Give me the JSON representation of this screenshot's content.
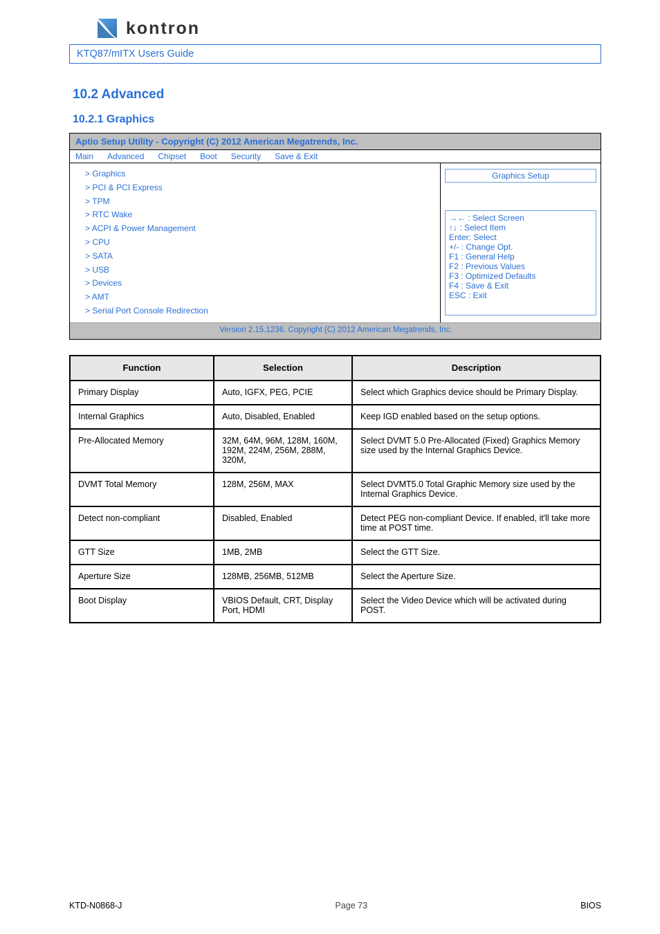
{
  "logo_text": "kontron",
  "titlebar": "KTQ87/mITX Users Guide",
  "sec_title": "10.2 Advanced",
  "sub_title": "10.2.1 Graphics",
  "shot": {
    "title": "Aptio Setup Utility - Copyright (C) 2012 American Megatrends, Inc.",
    "tabs": [
      "Main",
      "Advanced",
      "Chipset",
      "Boot",
      "Security",
      "Save & Exit"
    ],
    "items": [
      {
        "k": "> Graphics",
        "v": ""
      },
      {
        "k": "> PCI & PCI Express",
        "v": ""
      },
      {
        "k": "> TPM",
        "v": ""
      },
      {
        "k": "> RTC Wake",
        "v": ""
      },
      {
        "k": "> ACPI & Power Management",
        "v": ""
      },
      {
        "k": "> CPU",
        "v": ""
      },
      {
        "k": "> SATA",
        "v": ""
      },
      {
        "k": "> USB",
        "v": ""
      },
      {
        "k": "> Devices",
        "v": ""
      },
      {
        "k": "> AMT",
        "v": ""
      },
      {
        "k": "> Serial Port Console Redirection",
        "v": ""
      }
    ],
    "help_heading": "Graphics Setup",
    "help_rows": [
      "→←   : Select Screen",
      "↑↓    : Select Item",
      "Enter: Select",
      "+/-   : Change Opt.",
      "F1    : General Help",
      "F2    : Previous Values",
      "F3    : Optimized Defaults",
      "F4    : Save & Exit",
      "ESC  : Exit"
    ],
    "footer1": "Version 2.15.1236. Copyright (C) 2012 American Megatrends, Inc.",
    "footer2": ""
  },
  "table_head": [
    "Function",
    "Selection",
    "Description"
  ],
  "rows": [
    {
      "f": "Primary Display",
      "s": "Auto, IGFX, PEG, PCIE",
      "d": "Select which Graphics device should be Primary Display."
    },
    {
      "f": "Internal Graphics",
      "s": "Auto, Disabled, Enabled",
      "d": "Keep IGD enabled based on the setup options."
    },
    {
      "f": "Pre-Allocated Memory",
      "s": "32M, 64M, 96M, 128M, 160M, 192M, 224M, 256M, 288M, 320M,",
      "d": "Select DVMT 5.0 Pre-Allocated (Fixed) Graphics Memory size used by the Internal Graphics Device."
    },
    {
      "f": "DVMT Total Memory",
      "s": "128M, 256M, MAX",
      "d": "Select DVMT5.0 Total Graphic Memory size used by the Internal Graphics Device."
    },
    {
      "f": "Detect non-compliant",
      "s": "Disabled, Enabled",
      "d": "Detect PEG non-compliant Device. If enabled, it'll take more time at POST time."
    },
    {
      "f": "GTT Size",
      "s": "1MB, 2MB",
      "d": "Select the GTT Size."
    },
    {
      "f": "Aperture Size",
      "s": "128MB, 256MB, 512MB",
      "d": "Select the Aperture Size."
    },
    {
      "f": "Boot Display",
      "s": "VBIOS Default, CRT, Display Port, HDMI",
      "d": "Select the Video Device which will be activated during POST."
    }
  ],
  "footer": {
    "page": "KTD-N0868-J",
    "rev": "Page 73",
    "title": "BIOS"
  }
}
